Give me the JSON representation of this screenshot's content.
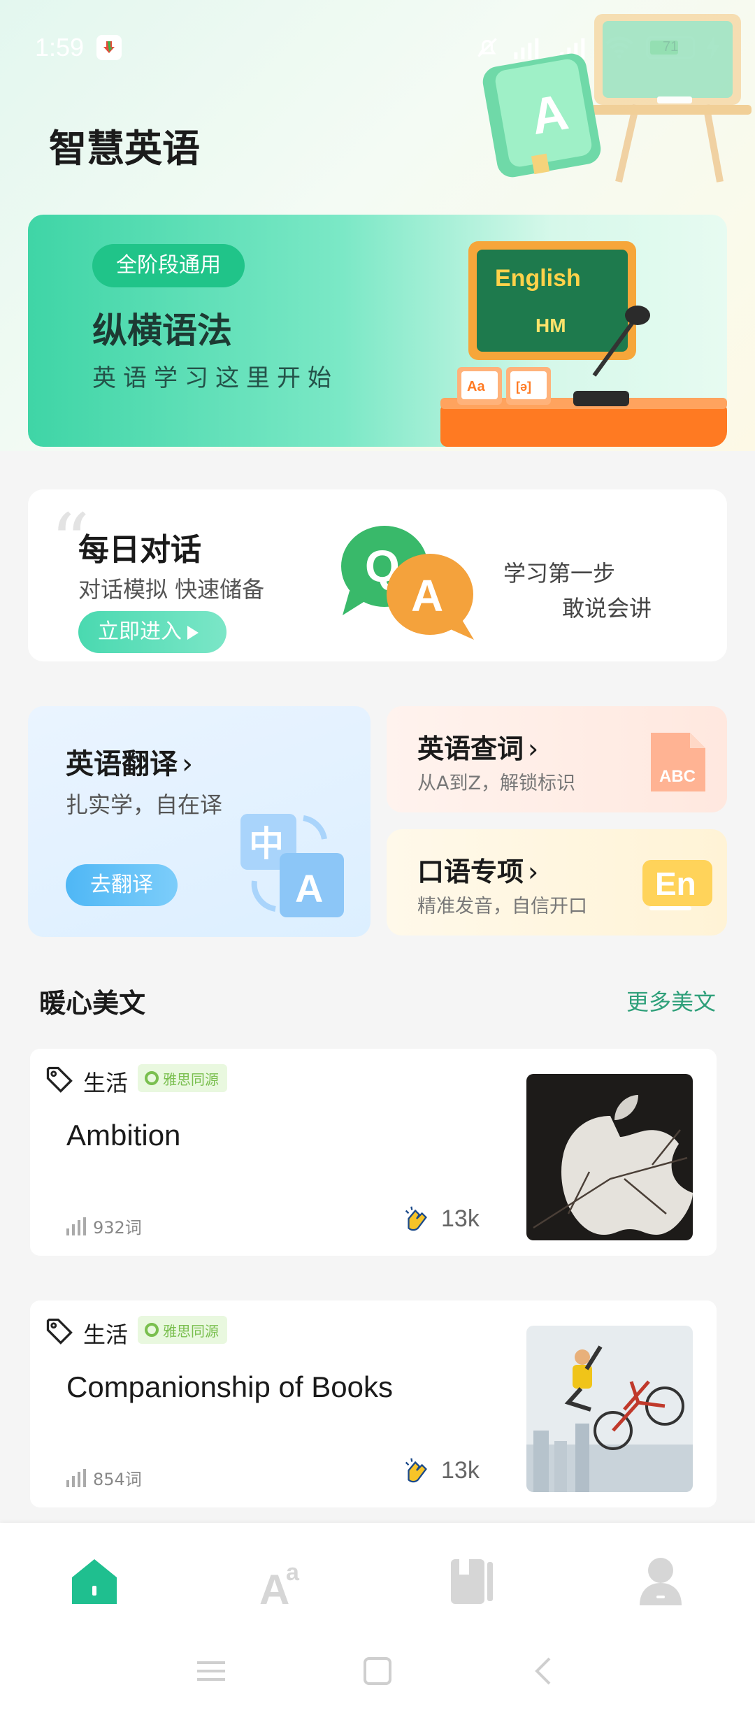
{
  "status_bar": {
    "time": "1:59",
    "battery": "71"
  },
  "header": {
    "title": "智慧英语"
  },
  "banner": {
    "tag": "全阶段通用",
    "title": "纵横语法",
    "subtitle": "英语学习这里开始",
    "board_text": "English",
    "board_sub": "HM"
  },
  "daily": {
    "title": "每日对话",
    "subtitle": "对话模拟 快速储备",
    "button": "立即进入",
    "step_line1": "学习第一步",
    "step_line2": "敢说会讲"
  },
  "translate": {
    "title": "英语翻译",
    "subtitle": "扎实学，自在译",
    "button": "去翻译"
  },
  "lookup": {
    "title": "英语查词",
    "subtitle": "从A到Z，解锁标识",
    "icon_text": "ABC"
  },
  "speak": {
    "title": "口语专项",
    "subtitle": "精准发音，自信开口",
    "icon_text": "En"
  },
  "section": {
    "title": "暖心美文",
    "more": "更多美文"
  },
  "articles": [
    {
      "category": "生活",
      "badge": "雅思同源",
      "title": "Ambition",
      "words": "932词",
      "likes": "13k"
    },
    {
      "category": "生活",
      "badge": "雅思同源",
      "title": "Companionship of Books",
      "words": "854词",
      "likes": "13k"
    }
  ],
  "colors": {
    "accent": "#20c489",
    "link": "#2fa07a"
  },
  "tabs": [
    "home-icon",
    "vocabulary-icon",
    "book-icon",
    "profile-icon"
  ]
}
